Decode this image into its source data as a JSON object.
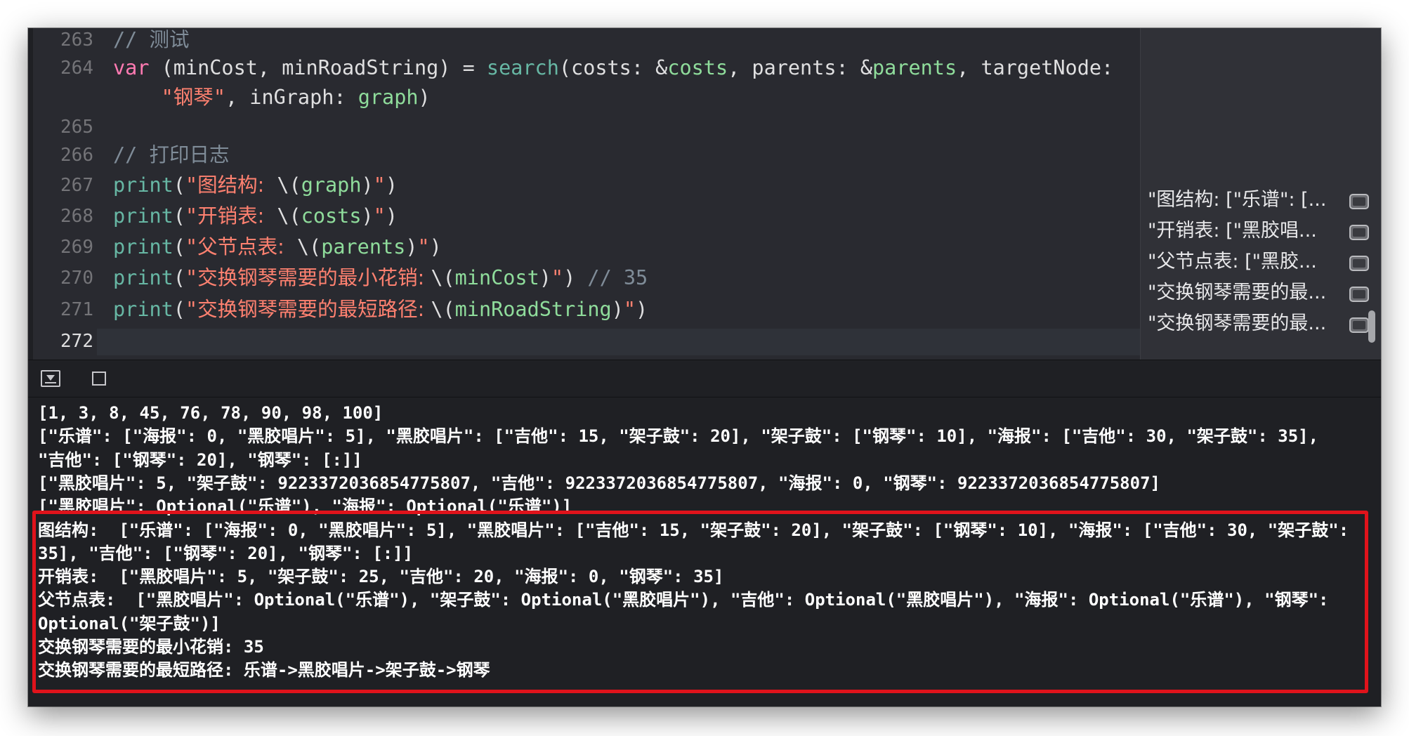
{
  "editor": {
    "line_numbers": [
      "263",
      "264",
      "",
      "265",
      "266",
      "267",
      "268",
      "269",
      "270",
      "271",
      "272"
    ],
    "lines": [
      {
        "segments": [
          {
            "t": "// ",
            "c": "cm"
          },
          {
            "t": "测试",
            "c": "cm han"
          }
        ]
      },
      {
        "segments": [
          {
            "t": "var",
            "c": "kw"
          },
          {
            "t": " (minCost, minRoadString) = ",
            "c": ""
          },
          {
            "t": "search",
            "c": "fn"
          },
          {
            "t": "(costs: &",
            "c": ""
          },
          {
            "t": "costs",
            "c": "id"
          },
          {
            "t": ", parents: &",
            "c": ""
          },
          {
            "t": "parents",
            "c": "id"
          },
          {
            "t": ", targetNode:",
            "c": ""
          }
        ]
      },
      {
        "segments": [
          {
            "t": "    \"",
            "c": "str"
          },
          {
            "t": "钢琴",
            "c": "str han"
          },
          {
            "t": "\"",
            "c": "str"
          },
          {
            "t": ", inGraph: ",
            "c": ""
          },
          {
            "t": "graph",
            "c": "id"
          },
          {
            "t": ")",
            "c": ""
          }
        ]
      },
      {
        "segments": []
      },
      {
        "segments": [
          {
            "t": "// ",
            "c": "cm"
          },
          {
            "t": "打印日志",
            "c": "cm han"
          }
        ]
      },
      {
        "segments": [
          {
            "t": "print",
            "c": "fn"
          },
          {
            "t": "(",
            "c": ""
          },
          {
            "t": "\"",
            "c": "str"
          },
          {
            "t": "图结构:  ",
            "c": "str han"
          },
          {
            "t": "\\(",
            "c": ""
          },
          {
            "t": "graph",
            "c": "id"
          },
          {
            "t": ")",
            "c": ""
          },
          {
            "t": "\"",
            "c": "str"
          },
          {
            "t": ")",
            "c": ""
          }
        ]
      },
      {
        "segments": [
          {
            "t": "print",
            "c": "fn"
          },
          {
            "t": "(",
            "c": ""
          },
          {
            "t": "\"",
            "c": "str"
          },
          {
            "t": "开销表:  ",
            "c": "str han"
          },
          {
            "t": "\\(",
            "c": ""
          },
          {
            "t": "costs",
            "c": "id"
          },
          {
            "t": ")",
            "c": ""
          },
          {
            "t": "\"",
            "c": "str"
          },
          {
            "t": ")",
            "c": ""
          }
        ]
      },
      {
        "segments": [
          {
            "t": "print",
            "c": "fn"
          },
          {
            "t": "(",
            "c": ""
          },
          {
            "t": "\"",
            "c": "str"
          },
          {
            "t": "父节点表:  ",
            "c": "str han"
          },
          {
            "t": "\\(",
            "c": ""
          },
          {
            "t": "parents",
            "c": "id"
          },
          {
            "t": ")",
            "c": ""
          },
          {
            "t": "\"",
            "c": "str"
          },
          {
            "t": ")",
            "c": ""
          }
        ]
      },
      {
        "segments": [
          {
            "t": "print",
            "c": "fn"
          },
          {
            "t": "(",
            "c": ""
          },
          {
            "t": "\"",
            "c": "str"
          },
          {
            "t": "交换钢琴需要的最小花销: ",
            "c": "str han"
          },
          {
            "t": "\\(",
            "c": ""
          },
          {
            "t": "minCost",
            "c": "id"
          },
          {
            "t": ")",
            "c": ""
          },
          {
            "t": "\"",
            "c": "str"
          },
          {
            "t": ") ",
            "c": ""
          },
          {
            "t": "// 35",
            "c": "cm"
          }
        ]
      },
      {
        "segments": [
          {
            "t": "print",
            "c": "fn"
          },
          {
            "t": "(",
            "c": ""
          },
          {
            "t": "\"",
            "c": "str"
          },
          {
            "t": "交换钢琴需要的最短路径: ",
            "c": "str han"
          },
          {
            "t": "\\(",
            "c": ""
          },
          {
            "t": "minRoadString",
            "c": "id"
          },
          {
            "t": ")",
            "c": ""
          },
          {
            "t": "\"",
            "c": "str"
          },
          {
            "t": ")",
            "c": ""
          }
        ]
      },
      {
        "segments": []
      }
    ]
  },
  "results_sidebar": {
    "items": [
      "\"图结构: [\"乐谱\": [...",
      "\"开销表: [\"黑胶唱...",
      "\"父节点表: [\"黑胶...",
      "\"交换钢琴需要的最...",
      "\"交换钢琴需要的最..."
    ]
  },
  "console": {
    "lines": [
      "[1, 3, 8, 45, 76, 78, 90, 98, 100]",
      "[\"乐谱\": [\"海报\": 0, \"黑胶唱片\": 5], \"黑胶唱片\": [\"吉他\": 15, \"架子鼓\": 20], \"架子鼓\": [\"钢琴\": 10], \"海报\": [\"吉他\": 30, \"架子鼓\": 35],",
      "\"吉他\": [\"钢琴\": 20], \"钢琴\": [:]]",
      "[\"黑胶唱片\": 5, \"架子鼓\": 9223372036854775807, \"吉他\": 9223372036854775807, \"海报\": 0, \"钢琴\": 9223372036854775807]",
      "[\"黑胶唱片\": Optional(\"乐谱\"), \"海报\": Optional(\"乐谱\")]",
      "图结构:  [\"乐谱\": [\"海报\": 0, \"黑胶唱片\": 5], \"黑胶唱片\": [\"吉他\": 15, \"架子鼓\": 20], \"架子鼓\": [\"钢琴\": 10], \"海报\": [\"吉他\": 30, \"架子鼓\":",
      "35], \"吉他\": [\"钢琴\": 20], \"钢琴\": [:]]",
      "开销表:  [\"黑胶唱片\": 5, \"架子鼓\": 25, \"吉他\": 20, \"海报\": 0, \"钢琴\": 35]",
      "父节点表:  [\"黑胶唱片\": Optional(\"乐谱\"), \"架子鼓\": Optional(\"黑胶唱片\"), \"吉他\": Optional(\"黑胶唱片\"), \"海报\": Optional(\"乐谱\"), \"钢琴\":",
      "Optional(\"架子鼓\")]",
      "交换钢琴需要的最小花销: 35",
      "交换钢琴需要的最短路径: 乐谱->黑胶唱片->架子鼓->钢琴"
    ]
  },
  "colors": {
    "highlight_border": "#e0131b",
    "editor_background": "#292a30",
    "console_background": "#1f2024"
  }
}
